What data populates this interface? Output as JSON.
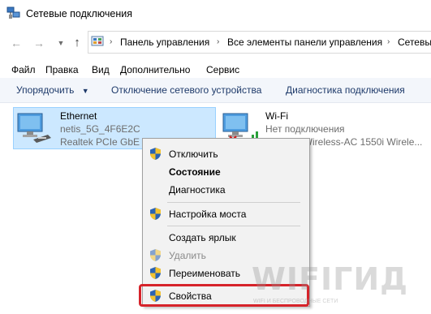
{
  "window": {
    "title": "Сетевые подключения",
    "icon": "network-connections-icon"
  },
  "navigation": {
    "back_icon": "arrow-left-icon",
    "forward_icon": "arrow-right-icon",
    "recent_icon": "chevron-down-icon",
    "up_icon": "arrow-up-icon",
    "breadcrumbs": [
      "Панель управления",
      "Все элементы панели управления",
      "Сетевы"
    ]
  },
  "menubar": {
    "items": [
      "Файл",
      "Правка",
      "Вид",
      "Дополнительно",
      "Сервис"
    ]
  },
  "commandbar": {
    "organize": "Упорядочить",
    "disable": "Отключение сетевого устройства",
    "diagnose": "Диагностика подключения"
  },
  "connections": [
    {
      "name": "Ethernet",
      "network": "netis_5G_4F6E2C",
      "device": "Realtek PCIe GbE Family Controller",
      "selected": true
    },
    {
      "name": "Wi-Fi",
      "status": "Нет подключения",
      "device": "Killer(R) Wireless-AC 1550i Wirele...",
      "selected": false
    }
  ],
  "context_menu": {
    "items": [
      {
        "label": "Отключить",
        "shield": true,
        "bold": false,
        "disabled": false
      },
      {
        "label": "Состояние",
        "shield": false,
        "bold": true,
        "disabled": false
      },
      {
        "label": "Диагностика",
        "shield": false,
        "bold": false,
        "disabled": false
      },
      {
        "label": "Настройка моста",
        "shield": true,
        "bold": false,
        "disabled": false
      },
      {
        "label": "Создать ярлык",
        "shield": false,
        "bold": false,
        "disabled": false
      },
      {
        "label": "Удалить",
        "shield": true,
        "bold": false,
        "disabled": true
      },
      {
        "label": "Переименовать",
        "shield": true,
        "bold": false,
        "disabled": false
      },
      {
        "label": "Свойства",
        "shield": true,
        "bold": false,
        "disabled": false,
        "highlighted": true
      }
    ]
  },
  "colors": {
    "selection_bg": "#cce8ff",
    "selection_border": "#99d1ff",
    "highlight_border": "#d6232a",
    "command_text": "#1e3a6a"
  },
  "watermark": {
    "text": "WIFIГИД",
    "subtitle": "WIFI И БЕСПРОВОДНЫЕ СЕТИ"
  }
}
